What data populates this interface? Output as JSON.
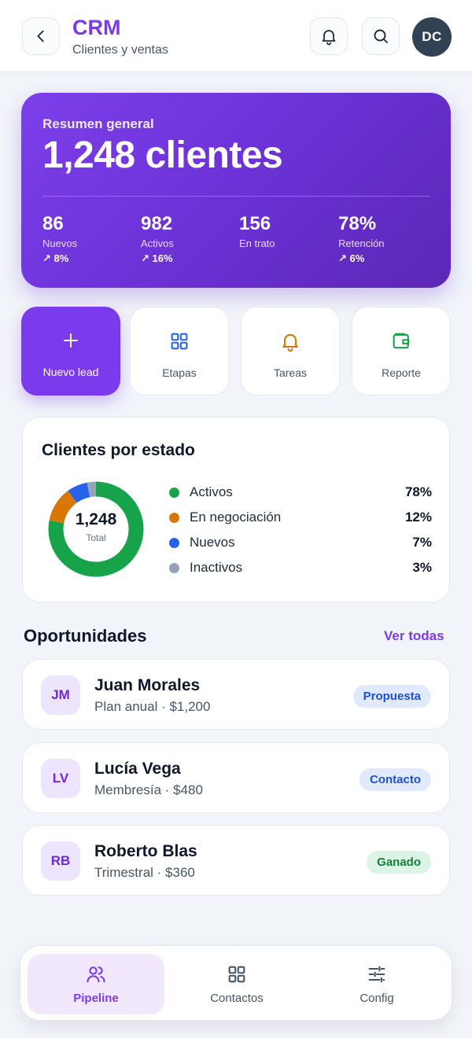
{
  "header": {
    "title": "CRM",
    "subtitle": "Clientes y ventas",
    "avatar_initials": "DC",
    "icons": [
      "chevron-left-icon",
      "bell-icon",
      "search-icon"
    ]
  },
  "summary": {
    "label": "Resumen general",
    "value": "1,248 clientes",
    "stats": [
      {
        "value": "86",
        "label": "Nuevos",
        "delta": "↗ 8%"
      },
      {
        "value": "982",
        "label": "Activos",
        "delta": "↗ 16%"
      },
      {
        "value": "156",
        "label": "En trato",
        "delta": ""
      },
      {
        "value": "78%",
        "label": "Retención",
        "delta": "↗ 6%"
      }
    ]
  },
  "quick_actions": [
    {
      "label": "Nuevo lead",
      "icon": "plus-icon"
    },
    {
      "label": "Etapas",
      "icon": "grid-icon"
    },
    {
      "label": "Tareas",
      "icon": "bell-icon"
    },
    {
      "label": "Reporte",
      "icon": "wallet-icon"
    }
  ],
  "status_card": {
    "title": "Clientes por estado",
    "total": "1,248",
    "total_caption": "Total",
    "chart_data": {
      "type": "pie",
      "categories": [
        "Activos",
        "En negociación",
        "Nuevos",
        "Inactivos"
      ],
      "values": [
        78,
        12,
        7,
        3
      ],
      "colors": [
        "#16a34a",
        "#d97706",
        "#2563eb",
        "#94a3b8"
      ]
    },
    "legend": [
      {
        "name": "Activos",
        "pct": "78%",
        "color": "#16a34a"
      },
      {
        "name": "En negociación",
        "pct": "12%",
        "color": "#d97706"
      },
      {
        "name": "Nuevos",
        "pct": "7%",
        "color": "#2563eb"
      },
      {
        "name": "Inactivos",
        "pct": "3%",
        "color": "#94a3b8"
      }
    ]
  },
  "opportunities": {
    "title": "Oportunidades",
    "see_all": "Ver todas",
    "items": [
      {
        "initials": "JM",
        "name": "Juan Morales",
        "detail": "Plan anual · $1,200",
        "status": "Propuesta"
      },
      {
        "initials": "LV",
        "name": "Lucía Vega",
        "detail": "Membresía · $480",
        "status": "Contacto"
      },
      {
        "initials": "RB",
        "name": "Roberto Blas",
        "detail": "Trimestral · $360",
        "status": "Ganado"
      }
    ]
  },
  "bottom_nav": {
    "items": [
      {
        "label": "Pipeline",
        "icon": "users-icon",
        "active": true
      },
      {
        "label": "Contactos",
        "icon": "grid-icon",
        "active": false
      },
      {
        "label": "Config",
        "icon": "sliders-icon",
        "active": false
      }
    ]
  },
  "colors": {
    "accent": "#7c3aed",
    "active_status": "#16a34a",
    "negotiation_status": "#d97706",
    "new_status": "#2563eb",
    "inactive_status": "#94a3b8"
  }
}
